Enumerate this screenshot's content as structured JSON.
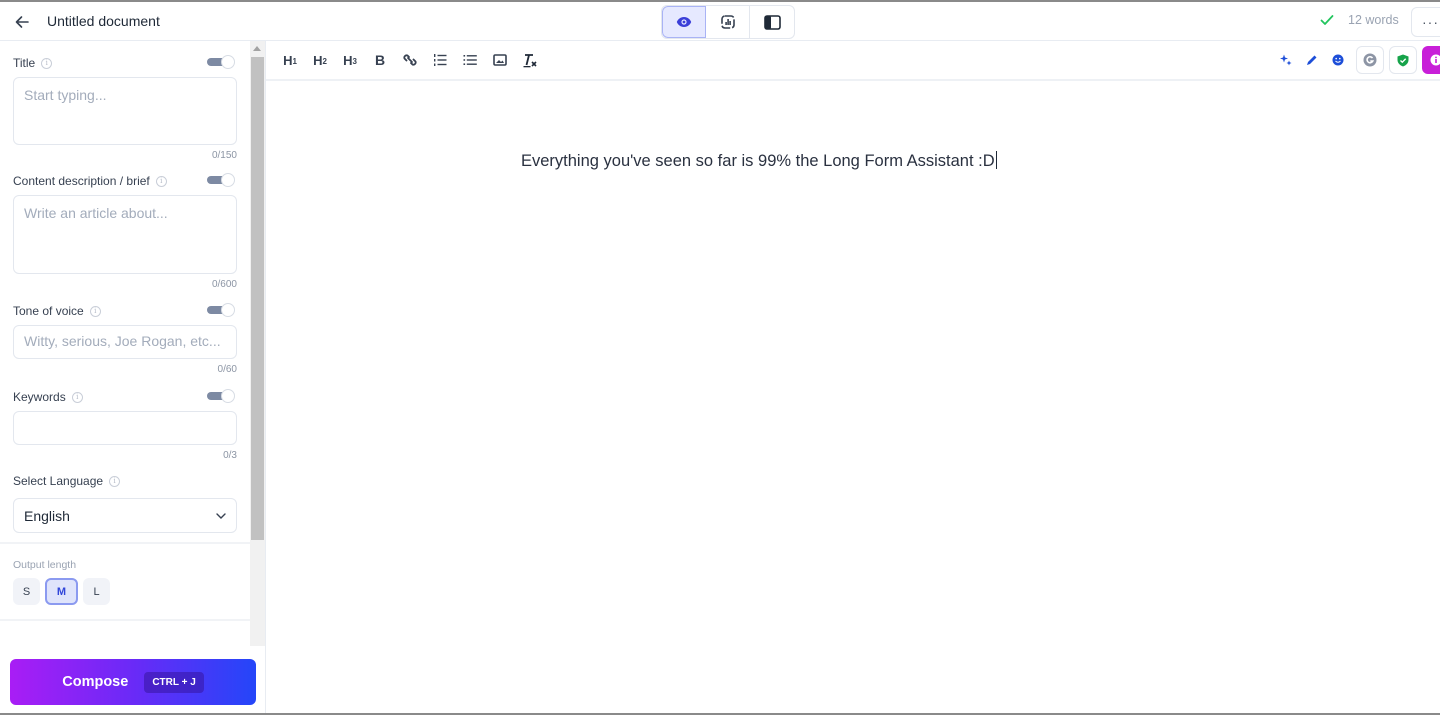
{
  "header": {
    "doc_title": "Untitled document",
    "view_modes": [
      {
        "name": "preview",
        "icon": "eye-icon",
        "active": true
      },
      {
        "name": "analytics",
        "icon": "chart-icon",
        "active": false
      },
      {
        "name": "sidebar-layout",
        "icon": "layout-sidebar-icon",
        "active": false
      }
    ],
    "status_icon": "check-icon",
    "word_count": "12 words",
    "more_label": "···"
  },
  "sidebar": {
    "fields": [
      {
        "label": "Title",
        "placeholder": "Start typing...",
        "value": "",
        "counter": "0/150",
        "enabled": true
      },
      {
        "label": "Content description / brief",
        "placeholder": "Write an article about...",
        "value": "",
        "counter": "0/600",
        "enabled": true
      },
      {
        "label": "Tone of voice",
        "placeholder": "Witty, serious, Joe Rogan, etc...",
        "value": "",
        "counter": "0/60",
        "enabled": true
      },
      {
        "label": "Keywords",
        "placeholder": "",
        "value": "",
        "counter": "0/3",
        "enabled": true
      }
    ],
    "language": {
      "label": "Select Language",
      "selected": "English"
    },
    "output_length": {
      "label": "Output length",
      "options": [
        "S",
        "M",
        "L"
      ],
      "selected": "M"
    },
    "compose": {
      "label": "Compose",
      "shortcut": "CTRL + J"
    }
  },
  "toolbar": {
    "items": [
      {
        "name": "heading-1",
        "label": "H",
        "sub": "1"
      },
      {
        "name": "heading-2",
        "label": "H",
        "sub": "2"
      },
      {
        "name": "heading-3",
        "label": "H",
        "sub": "3"
      },
      {
        "name": "bold",
        "label": "B"
      },
      {
        "name": "link"
      },
      {
        "name": "ordered-list"
      },
      {
        "name": "bullet-list"
      },
      {
        "name": "image"
      },
      {
        "name": "clear-format",
        "label": "T"
      }
    ],
    "right_tools": [
      "sparkles",
      "pen",
      "smiley",
      "grammarly",
      "shield-check",
      "info"
    ]
  },
  "editor": {
    "content": "Everything you've seen so far is 99% the Long Form Assistant :D"
  },
  "colors": {
    "accent": "#3146d9",
    "compose_gradient_start": "#a91df5",
    "compose_gradient_end": "#2446f9",
    "success": "#22c55e",
    "info_button": "#c81fd8"
  }
}
